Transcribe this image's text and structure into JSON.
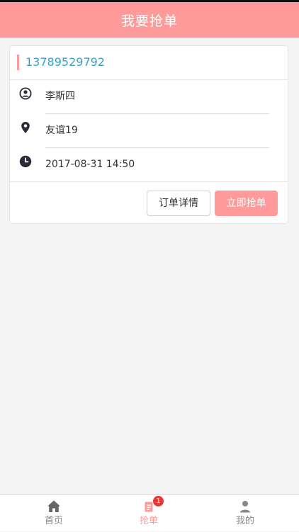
{
  "header": {
    "title": "我要抢单"
  },
  "order": {
    "phone": "13789529792",
    "name": "李斯四",
    "address": "友谊19",
    "time": "2017-08-31 14:50"
  },
  "actions": {
    "detail_label": "订单详情",
    "grab_label": "立即抢单"
  },
  "tabbar": {
    "tabs": [
      {
        "label": "首页",
        "icon": "home-icon",
        "active": false
      },
      {
        "label": "抢单",
        "icon": "document-icon",
        "active": true,
        "badge": "1"
      },
      {
        "label": "我的",
        "icon": "person-icon",
        "active": false
      }
    ]
  },
  "colors": {
    "brand": "#ff9a9a",
    "phone_text": "#3a9fc4",
    "badge": "#e53935",
    "inactive_tab": "#888888",
    "icon_dark": "#2b2b3a"
  }
}
